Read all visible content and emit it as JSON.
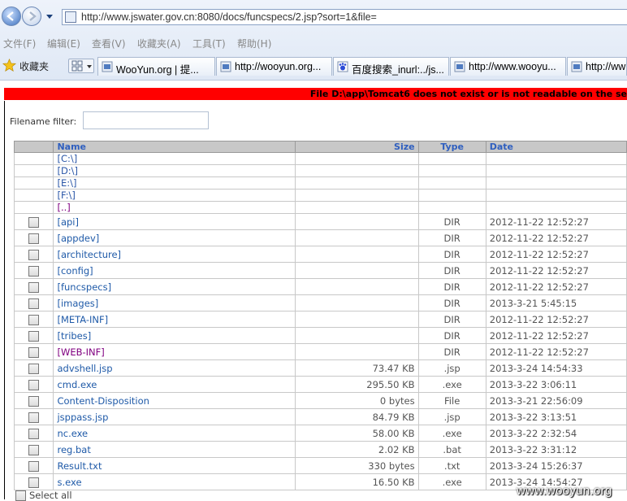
{
  "browser": {
    "url": "http://www.jswater.gov.cn:8080/docs/funcspecs/2.jsp?sort=1&file=",
    "menu": [
      "文件(F)",
      "编辑(E)",
      "查看(V)",
      "收藏夹(A)",
      "工具(T)",
      "帮助(H)"
    ],
    "favorites_label": "收藏夹",
    "tabs": [
      {
        "label": "WooYun.org | 提...",
        "icon": "wooyun-icon"
      },
      {
        "label": "http://wooyun.org...",
        "icon": "page-icon"
      },
      {
        "label": "百度搜索_inurl:../js...",
        "icon": "baidu-icon"
      },
      {
        "label": "http://www.wooyu...",
        "icon": "page-icon"
      },
      {
        "label": "http://ww",
        "icon": "page-icon"
      }
    ]
  },
  "page": {
    "error": "File D:\\app\\Tomcat6 does not exist or is not readable on the se",
    "filter_label": "Filename filter:",
    "filter_value": "",
    "headers": {
      "name": "Name",
      "size": "Size",
      "type": "Type",
      "date": "Date"
    },
    "drives": [
      "[C:\\]",
      "[D:\\]",
      "[E:\\]",
      "[F:\\]",
      "[..]"
    ],
    "files": [
      {
        "name": "[api]",
        "size": "",
        "type": "DIR",
        "date": "2012-11-22 12:52:27"
      },
      {
        "name": "[appdev]",
        "size": "",
        "type": "DIR",
        "date": "2012-11-22 12:52:27"
      },
      {
        "name": "[architecture]",
        "size": "",
        "type": "DIR",
        "date": "2012-11-22 12:52:27"
      },
      {
        "name": "[config]",
        "size": "",
        "type": "DIR",
        "date": "2012-11-22 12:52:27"
      },
      {
        "name": "[funcspecs]",
        "size": "",
        "type": "DIR",
        "date": "2012-11-22 12:52:27"
      },
      {
        "name": "[images]",
        "size": "",
        "type": "DIR",
        "date": "2013-3-21 5:45:15"
      },
      {
        "name": "[META-INF]",
        "size": "",
        "type": "DIR",
        "date": "2012-11-22 12:52:27"
      },
      {
        "name": "[tribes]",
        "size": "",
        "type": "DIR",
        "date": "2012-11-22 12:52:27"
      },
      {
        "name": "[WEB-INF]",
        "size": "",
        "type": "DIR",
        "date": "2012-11-22 12:52:27"
      },
      {
        "name": "advshell.jsp",
        "size": "73.47 KB",
        "type": ".jsp",
        "date": "2013-3-24 14:54:33"
      },
      {
        "name": "cmd.exe",
        "size": "295.50 KB",
        "type": ".exe",
        "date": "2013-3-22 3:06:11"
      },
      {
        "name": "Content-Disposition",
        "size": "0 bytes",
        "type": "File",
        "date": "2013-3-21 22:56:09"
      },
      {
        "name": "jsppass.jsp",
        "size": "84.79 KB",
        "type": ".jsp",
        "date": "2013-3-22 3:13:51"
      },
      {
        "name": "nc.exe",
        "size": "58.00 KB",
        "type": ".exe",
        "date": "2013-3-22 2:32:54"
      },
      {
        "name": "reg.bat",
        "size": "2.02 KB",
        "type": ".bat",
        "date": "2013-3-22 3:31:12"
      },
      {
        "name": "Result.txt",
        "size": "330 bytes",
        "type": ".txt",
        "date": "2013-3-24 15:26:37"
      },
      {
        "name": "s.exe",
        "size": "16.50 KB",
        "type": ".exe",
        "date": "2013-3-24 14:54:27"
      }
    ],
    "select_all": "Select all"
  },
  "watermark": "www.wooyun.org",
  "colors": {
    "error_bar": "#ff0000",
    "link": "#1f5aa8",
    "visited": "#800080",
    "header_bg": "#c8c8c8"
  }
}
